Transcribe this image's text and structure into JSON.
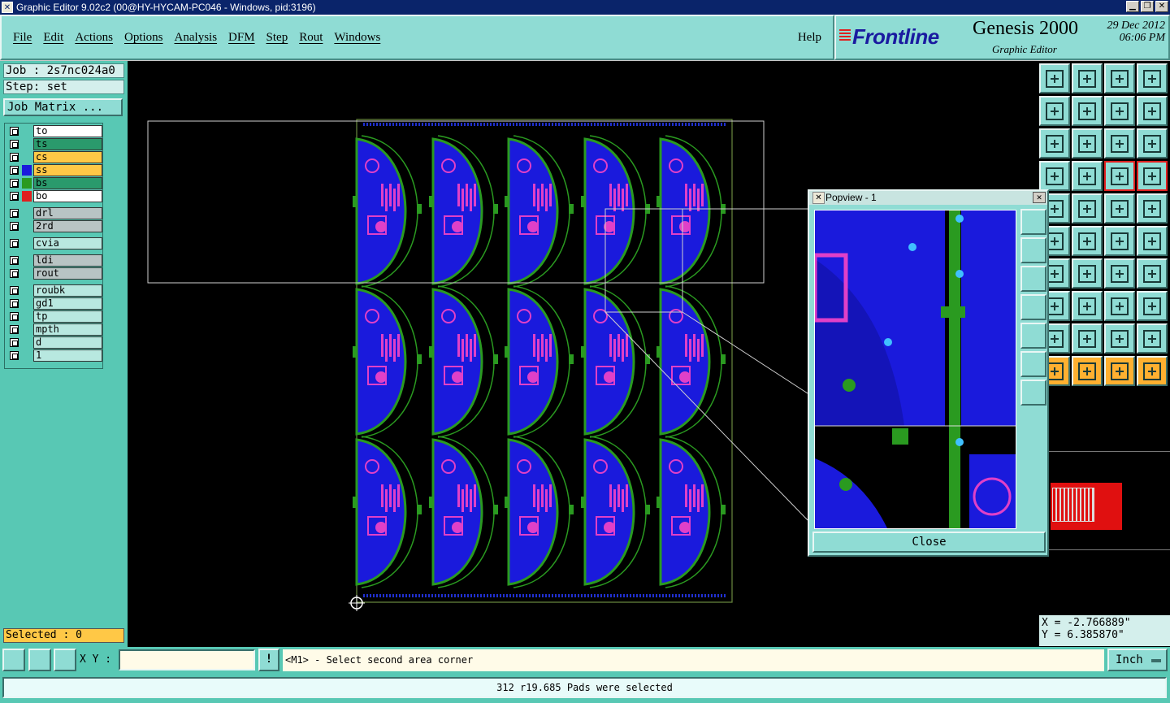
{
  "window": {
    "title": "Graphic Editor 9.02c2 (00@HY-HYCAM-PC046 - Windows, pid:3196)"
  },
  "menu": {
    "items": [
      "File",
      "Edit",
      "Actions",
      "Options",
      "Analysis",
      "DFM",
      "Step",
      "Rout",
      "Windows"
    ],
    "help": "Help"
  },
  "brand": {
    "logo": "Frontline",
    "product": "Genesis 2000",
    "subtitle": "Graphic Editor",
    "date": "29 Dec 2012",
    "time": "06:06 PM"
  },
  "job": {
    "job_label": "Job : 2s7nc024a0",
    "step_label": "Step: set",
    "matrix_button": "Job Matrix ..."
  },
  "layers": [
    {
      "name": "to",
      "color": "#ffffff",
      "swatch": ""
    },
    {
      "name": "ts",
      "color": "#2a9a6c",
      "swatch": ""
    },
    {
      "name": "cs",
      "color": "#ffc846",
      "swatch": ""
    },
    {
      "name": "ss",
      "color": "#ffc846",
      "swatch": "#1a1adc"
    },
    {
      "name": "bs",
      "color": "#2a9a6c",
      "swatch": "#2a9a20"
    },
    {
      "name": "bo",
      "color": "#ffffff",
      "swatch": "#e02020"
    },
    {
      "name": "drl",
      "color": "#b8c4c4",
      "swatch": ""
    },
    {
      "name": "2rd",
      "color": "#b8c4c4",
      "swatch": ""
    },
    {
      "name": "cvia",
      "color": "#b8e8e0",
      "swatch": ""
    },
    {
      "name": "ldi",
      "color": "#b8c4c4",
      "swatch": ""
    },
    {
      "name": "rout",
      "color": "#b8c4c4",
      "swatch": ""
    },
    {
      "name": "roubk",
      "color": "#b8e8e0",
      "swatch": ""
    },
    {
      "name": "gd1",
      "color": "#b8e8e0",
      "swatch": ""
    },
    {
      "name": "tp",
      "color": "#b8e8e0",
      "swatch": ""
    },
    {
      "name": "mpth",
      "color": "#b8e8e0",
      "swatch": ""
    },
    {
      "name": "d",
      "color": "#b8e8e0",
      "swatch": ""
    },
    {
      "name": "1",
      "color": "#b8e8e0",
      "swatch": ""
    }
  ],
  "selected": "Selected : 0",
  "popview": {
    "title": "Popview - 1",
    "close": "Close"
  },
  "coords": {
    "x": "X = -2.766889\"",
    "y": "Y = 6.385870\""
  },
  "command": {
    "xy_label": "X Y :",
    "xy_value": "",
    "bang": "!",
    "prompt": "<M1> - Select second area corner",
    "units": "Inch"
  },
  "status": "312 r19.685 Pads were selected",
  "colors": {
    "board_blue": "#1a1adc",
    "trace_green": "#2a9a20",
    "silk_magenta": "#e040c8",
    "panel_teal": "#58c8b4",
    "button_teal": "#8fdcd4"
  }
}
